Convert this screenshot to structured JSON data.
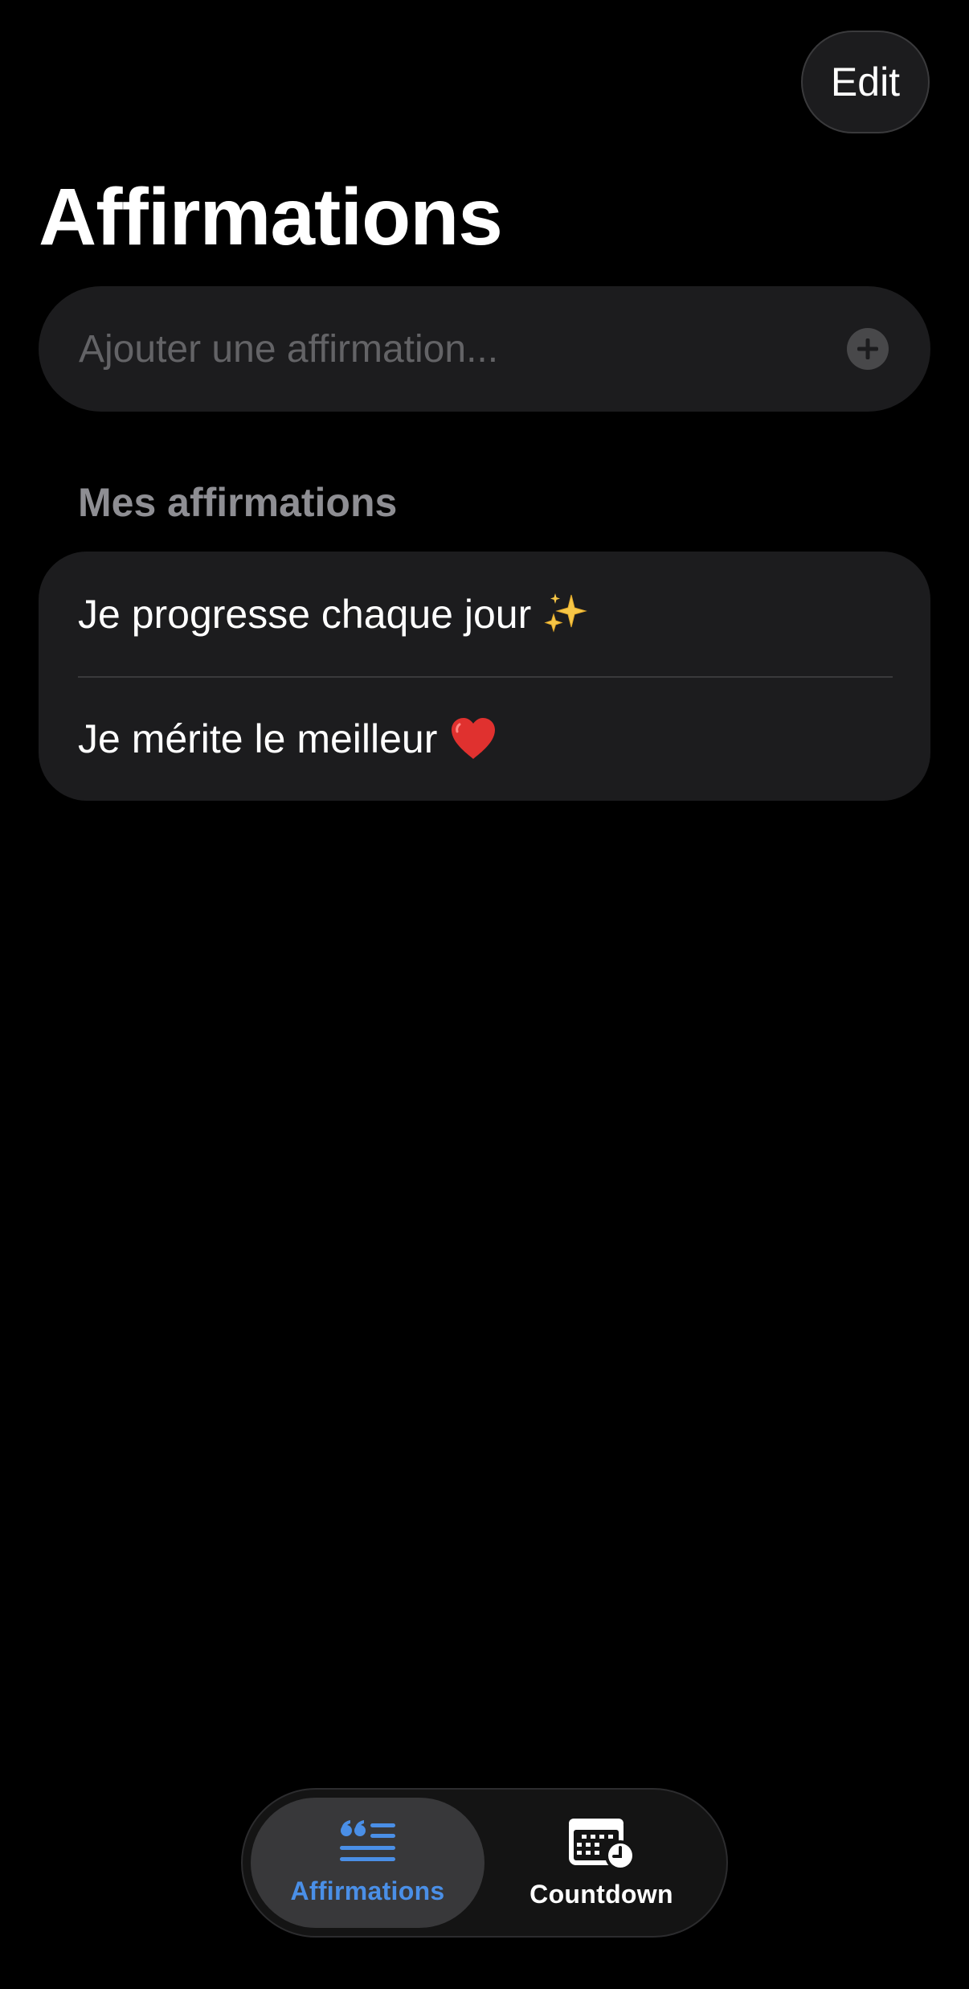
{
  "header": {
    "edit_label": "Edit",
    "title": "Affirmations"
  },
  "add_field": {
    "placeholder": "Ajouter une affirmation...",
    "value": ""
  },
  "section": {
    "title": "Mes affirmations"
  },
  "affirmations": [
    {
      "text": "Je progresse chaque jour",
      "emoji": "sparkles-emoji"
    },
    {
      "text": "Je mérite le meilleur",
      "emoji": "red-heart-emoji"
    }
  ],
  "tab_bar": {
    "tabs": [
      {
        "label": "Affirmations",
        "icon": "quote-list-icon",
        "active": true
      },
      {
        "label": "Countdown",
        "icon": "calendar-clock-icon",
        "active": false
      }
    ]
  },
  "colors": {
    "background": "#000000",
    "surface": "#1c1c1e",
    "accent": "#4a8fe7",
    "secondary_text": "#8e8e93",
    "placeholder_text": "#636366"
  }
}
